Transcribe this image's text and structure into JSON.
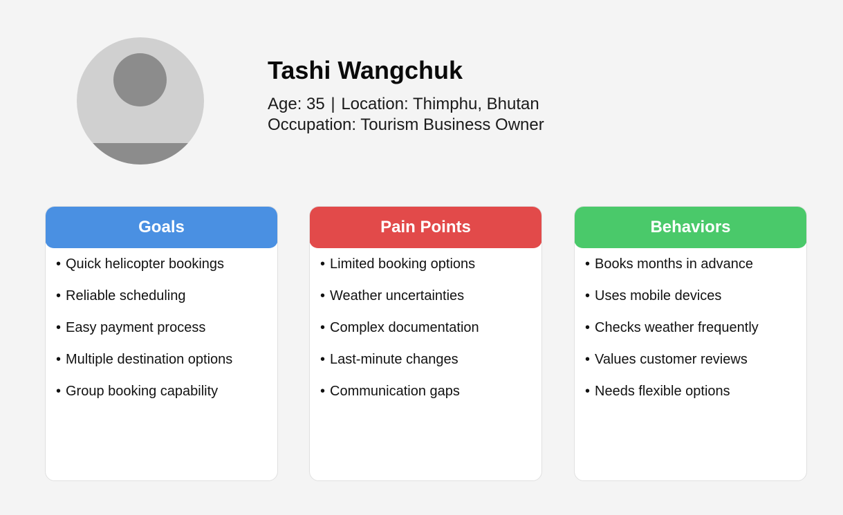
{
  "persona": {
    "name": "Tashi Wangchuk",
    "age_label": "Age: 35",
    "separator": "|",
    "location_label": "Location: Thimphu, Bhutan",
    "occupation_label": "Occupation: Tourism Business Owner",
    "avatar_icon": "user-avatar-placeholder"
  },
  "cards": [
    {
      "title": "Goals",
      "color": "#4a90e2",
      "items": [
        "Quick helicopter bookings",
        "Reliable scheduling",
        "Easy payment process",
        "Multiple destination options",
        "Group booking capability"
      ]
    },
    {
      "title": "Pain Points",
      "color": "#e24a4a",
      "items": [
        "Limited booking options",
        "Weather uncertainties",
        "Complex documentation",
        "Last-minute changes",
        "Communication gaps"
      ]
    },
    {
      "title": "Behaviors",
      "color": "#4ac96a",
      "items": [
        "Books months in advance",
        "Uses mobile devices",
        "Checks weather frequently",
        "Values customer reviews",
        "Needs flexible options"
      ]
    }
  ],
  "bullet": "•",
  "colors": {
    "background": "#f4f4f4",
    "avatar_light": "#d0d0d0",
    "avatar_dark": "#8c8c8c"
  }
}
